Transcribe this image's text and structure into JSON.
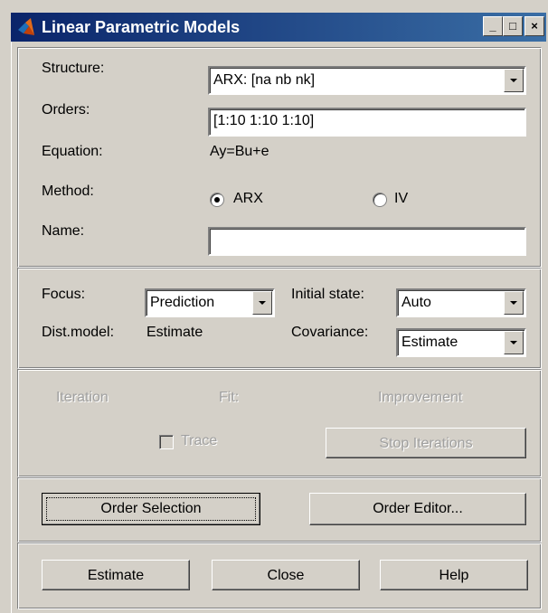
{
  "window": {
    "title": "Linear Parametric Models",
    "min": "_",
    "max": "□",
    "close": "×"
  },
  "model": {
    "structure_label": "Structure:",
    "structure_value": "ARX: [na nb nk]",
    "orders_label": "Orders:",
    "orders_value": "[1:10 1:10 1:10]",
    "equation_label": "Equation:",
    "equation_value": "Ay=Bu+e",
    "method_label": "Method:",
    "method_arx": "ARX",
    "method_iv": "IV",
    "method_selected": "ARX",
    "name_label": "Name:",
    "name_value": ""
  },
  "options": {
    "focus_label": "Focus:",
    "focus_value": "Prediction",
    "initial_state_label": "Initial state:",
    "initial_state_value": "Auto",
    "dist_model_label": "Dist.model:",
    "dist_model_value": "Estimate",
    "covariance_label": "Covariance:",
    "covariance_value": "Estimate"
  },
  "iteration": {
    "iteration_label": "Iteration",
    "fit_label": "Fit:",
    "improvement_label": "Improvement",
    "trace_label": "Trace",
    "stop_label": "Stop Iterations"
  },
  "order": {
    "selection_label": "Order Selection",
    "editor_label": "Order Editor..."
  },
  "actions": {
    "estimate": "Estimate",
    "close": "Close",
    "help": "Help"
  }
}
